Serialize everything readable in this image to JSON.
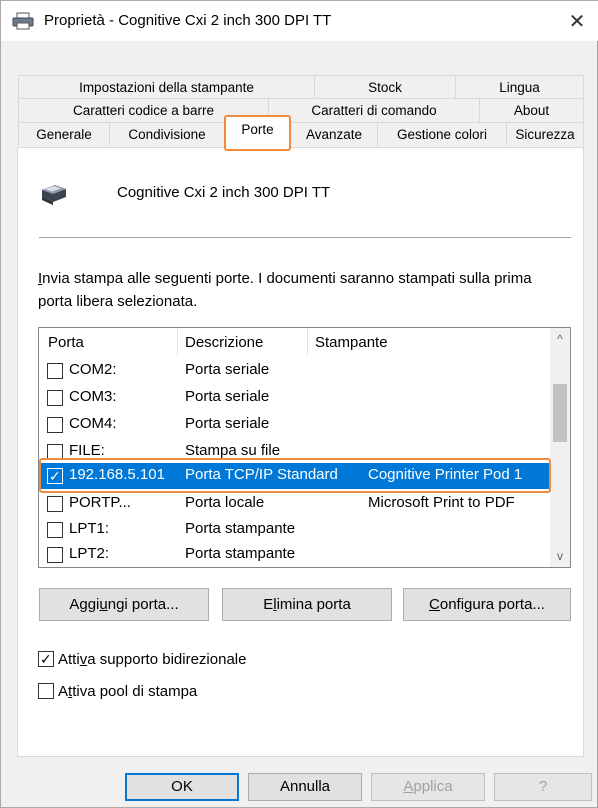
{
  "window": {
    "title": "Proprietà - Cognitive Cxi 2 inch 300 DPI TT",
    "close_glyph": "✕"
  },
  "tabs": {
    "row1": [
      "Impostazioni della stampante",
      "Stock",
      "Lingua"
    ],
    "row2": [
      "Caratteri codice a barre",
      "Caratteri di comando",
      "About"
    ],
    "row3": [
      "Generale",
      "Condivisione",
      "Porte",
      "Avanzate",
      "Gestione colori",
      "Sicurezza"
    ],
    "active": "Porte"
  },
  "printer": {
    "name": "Cognitive Cxi 2 inch 300 DPI TT"
  },
  "description": {
    "first_letter": "I",
    "rest": "nvia stampa alle seguenti porte. I documenti saranno stampati sulla prima porta libera selezionata."
  },
  "port_list": {
    "headers": [
      "Porta",
      "Descrizione",
      "Stampante"
    ],
    "rows": [
      {
        "port": "COM2:",
        "description": "Porta seriale",
        "printer": "",
        "checked": false,
        "selected": false
      },
      {
        "port": "COM3:",
        "description": "Porta seriale",
        "printer": "",
        "checked": false,
        "selected": false
      },
      {
        "port": "COM4:",
        "description": "Porta seriale",
        "printer": "",
        "checked": false,
        "selected": false
      },
      {
        "port": "FILE:",
        "description": "Stampa su file",
        "printer": "",
        "checked": false,
        "selected": false
      },
      {
        "port": "192.168.5.101",
        "description": "Porta TCP/IP Standard",
        "printer": "Cognitive Printer Pod 1",
        "checked": true,
        "selected": true
      },
      {
        "port": "PORTP...",
        "description": "Porta locale",
        "printer": "Microsoft Print to PDF",
        "checked": false,
        "selected": false
      },
      {
        "port": "LPT1:",
        "description": "Porta stampante",
        "printer": "",
        "checked": false,
        "selected": false
      },
      {
        "port": "LPT2:",
        "description": "Porta stampante",
        "printer": "",
        "checked": false,
        "selected": false
      }
    ],
    "scroll_up_glyph": "^",
    "scroll_down_glyph": "v"
  },
  "port_buttons": {
    "add_pre": "Aggi",
    "add_u": "u",
    "add_post": "ngi porta...",
    "delete_pre": "E",
    "delete_u": "l",
    "delete_post": "imina porta",
    "configure_u": "C",
    "configure_post": "onfigura porta..."
  },
  "options": {
    "bidirectional": {
      "pre": "Atti",
      "u": "v",
      "post": "a supporto bidirezionale",
      "checked": true
    },
    "pool": {
      "pre": "A",
      "u": "t",
      "post": "tiva pool di stampa",
      "checked": false
    },
    "check_glyph": "✓"
  },
  "footer": {
    "ok": "OK",
    "cancel": "Annulla",
    "apply_u": "A",
    "apply_post": "pplica",
    "help": "?"
  },
  "colors": {
    "accent_orange": "#f08a3c",
    "selection_blue": "#0078d7"
  }
}
